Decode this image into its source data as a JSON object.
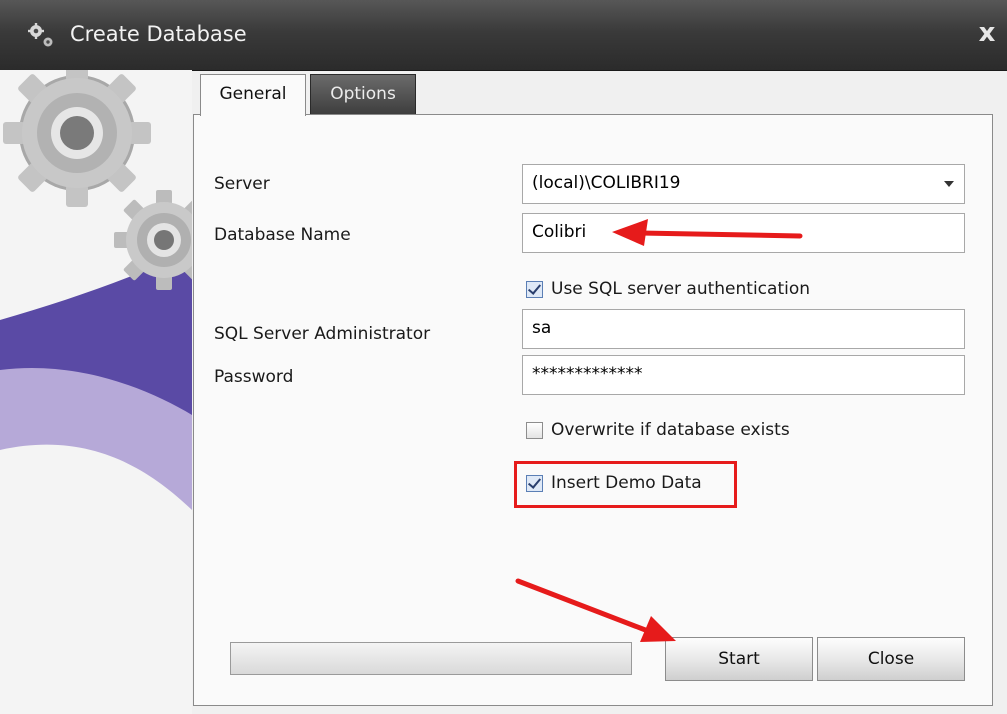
{
  "window": {
    "title": "Create Database",
    "close_glyph": "x"
  },
  "tabs": [
    {
      "label": "General",
      "active": true
    },
    {
      "label": "Options",
      "active": false
    }
  ],
  "form": {
    "server_label": "Server",
    "server_value": "(local)\\COLIBRI19",
    "database_name_label": "Database Name",
    "database_name_value": "Colibri",
    "use_sql_auth_label": "Use SQL server authentication",
    "use_sql_auth_checked": true,
    "admin_label": "SQL Server Administrator",
    "admin_value": "sa",
    "password_label": "Password",
    "password_value": "*************",
    "overwrite_label": "Overwrite if database exists",
    "overwrite_checked": false,
    "demo_data_label": "Insert Demo Data",
    "demo_data_checked": true
  },
  "progress": 0,
  "buttons": {
    "start_label": "Start",
    "close_label": "Close"
  },
  "icons": [
    "gears-icon",
    "close-icon",
    "dropdown-arrow-icon",
    "checkbox-icon"
  ],
  "colors": {
    "annotation_red": "#e61b1b",
    "titlebar": "#3a3a3a",
    "purple_wave": "#5a4ba3",
    "lavender_wave": "#b9addb"
  }
}
